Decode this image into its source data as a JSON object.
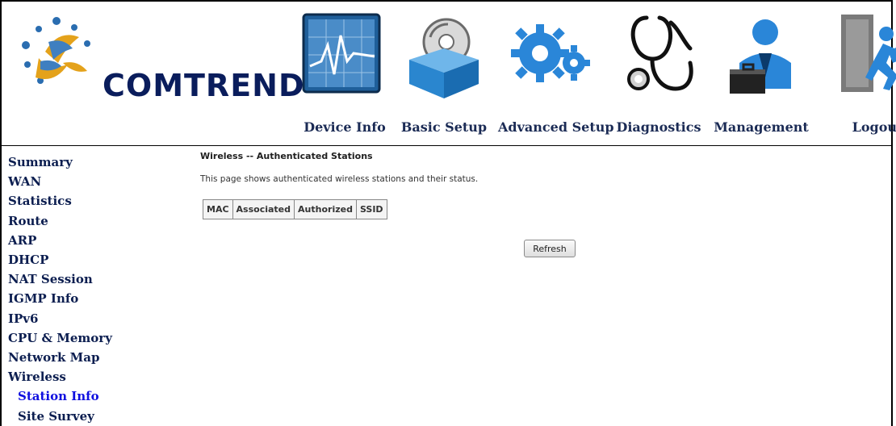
{
  "brand": {
    "name": "COMTREND"
  },
  "nav": [
    {
      "label": "Device Info",
      "icon": "monitor-chart-icon"
    },
    {
      "label": "Basic Setup",
      "icon": "box-disc-icon"
    },
    {
      "label": "Advanced Setup",
      "icon": "gears-icon"
    },
    {
      "label": "Diagnostics",
      "icon": "stethoscope-icon"
    },
    {
      "label": "Management",
      "icon": "user-briefcase-icon"
    },
    {
      "label": "Logout",
      "icon": "exit-door-icon"
    }
  ],
  "sidebar": {
    "items": [
      {
        "label": "Summary"
      },
      {
        "label": "WAN"
      },
      {
        "label": "Statistics"
      },
      {
        "label": "Route"
      },
      {
        "label": "ARP"
      },
      {
        "label": "DHCP"
      },
      {
        "label": "NAT Session"
      },
      {
        "label": "IGMP Info"
      },
      {
        "label": "IPv6"
      },
      {
        "label": "CPU & Memory"
      },
      {
        "label": "Network Map"
      },
      {
        "label": "Wireless"
      },
      {
        "label": "Station Info"
      },
      {
        "label": "Site Survey"
      }
    ]
  },
  "main": {
    "title": "Wireless -- Authenticated Stations",
    "description": "This page shows authenticated wireless stations and their status.",
    "table": {
      "headers": [
        "MAC",
        "Associated",
        "Authorized",
        "SSID"
      ],
      "rows": []
    },
    "refresh_label": "Refresh"
  },
  "colors": {
    "nav_text": "#1b2b55",
    "sidebar_text": "#0c1e50",
    "active": "#1010e0",
    "logo_blue": "#0a1d5c"
  }
}
